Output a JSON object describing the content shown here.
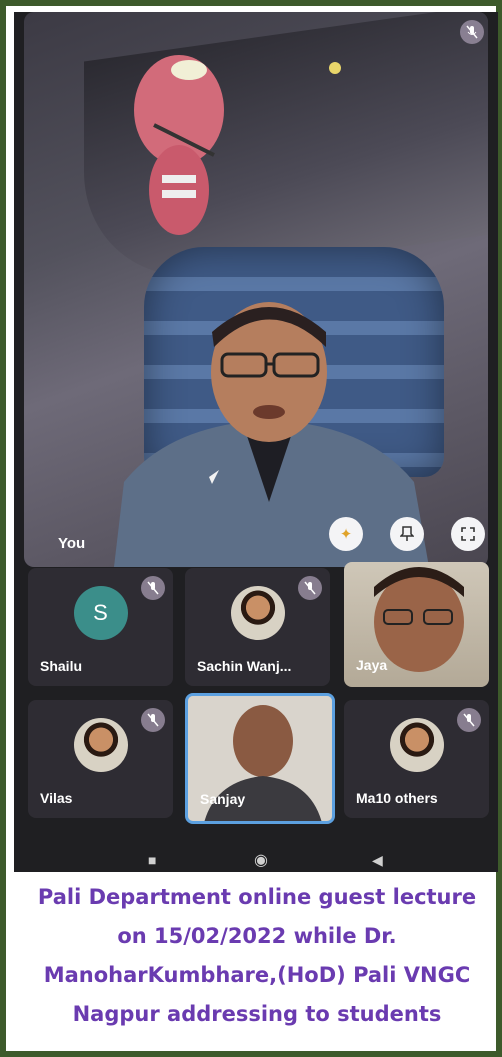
{
  "meeting": {
    "self_label": "You",
    "controls": {
      "effects_icon": "sparkle-icon",
      "pin_icon": "pin-icon",
      "fullscreen_icon": "fullscreen-icon"
    }
  },
  "participants": [
    {
      "name": "Shailu",
      "initial": "S",
      "muted": true,
      "type": "initial"
    },
    {
      "name": "Sachin Wanj...",
      "muted": true,
      "type": "photo"
    },
    {
      "name": "Jaya",
      "muted": false,
      "type": "video"
    },
    {
      "name": "Vilas",
      "muted": true,
      "type": "photo"
    },
    {
      "name": "Sanjay",
      "muted": false,
      "type": "video",
      "active_speaker": true
    },
    {
      "name": "Ma10 others",
      "muted": true,
      "type": "photo"
    }
  ],
  "navbar": {
    "recents_icon": "square-icon",
    "home_icon": "circle-icon",
    "back_icon": "triangle-back-icon"
  },
  "caption": {
    "lines": [
      "Pali Department online guest lecture",
      "on 15/02/2022 while Dr.",
      "ManoharKumbhare,(HoD) Pali VNGC",
      "Nagpur addressing to students"
    ],
    "color": "#6a3bb0"
  },
  "colors": {
    "frame_border": "#3d5a2b",
    "speaker_highlight": "#5ca0e0",
    "avatar_bg": "#3b8e8a"
  }
}
